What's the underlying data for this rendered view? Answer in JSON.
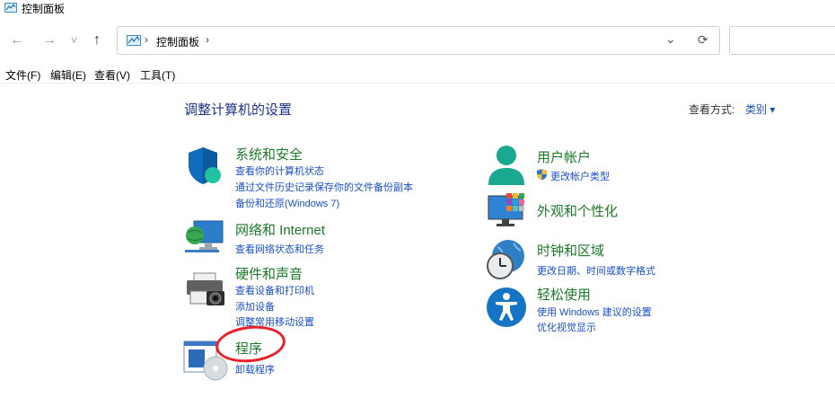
{
  "window": {
    "title": "控制面板"
  },
  "address": {
    "separator": "›",
    "location": "控制面板"
  },
  "nav": {
    "back": "←",
    "forward": "→",
    "recent": "˅",
    "up": "↑",
    "dropdown": "⌄",
    "refresh": "⟳"
  },
  "menu": {
    "file": "文件(F)",
    "edit": "编辑(E)",
    "view": "查看(V)",
    "tools": "工具(T)"
  },
  "main": {
    "heading": "调整计算机的设置"
  },
  "view_by": {
    "label": "查看方式:",
    "value": "类别",
    "arrow": "▾"
  },
  "categories": {
    "security": {
      "title": "系统和安全",
      "links": [
        "查看你的计算机状态",
        "通过文件历史记录保存你的文件备份副本",
        "备份和还原(Windows 7)"
      ],
      "icon": "shield-icon"
    },
    "network": {
      "title": "网络和 Internet",
      "links": [
        "查看网络状态和任务"
      ],
      "icon": "network-globe-icon"
    },
    "hardware": {
      "title": "硬件和声音",
      "links": [
        "查看设备和打印机",
        "添加设备",
        "调整常用移动设置"
      ],
      "icon": "printer-camera-icon"
    },
    "programs": {
      "title": "程序",
      "links": [
        "卸载程序"
      ],
      "icon": "programs-disc-icon"
    },
    "accounts": {
      "title": "用户帐户",
      "links": [
        "更改帐户类型"
      ],
      "icon": "user-icon"
    },
    "appearance": {
      "title": "外观和个性化",
      "links": [],
      "icon": "monitor-icon"
    },
    "clock": {
      "title": "时钟和区域",
      "links": [
        "更改日期、时间或数字格式"
      ],
      "icon": "clock-globe-icon"
    },
    "ease": {
      "title": "轻松使用",
      "links": [
        "使用 Windows 建议的设置",
        "优化视觉显示"
      ],
      "icon": "accessibility-icon"
    }
  },
  "colors": {
    "title_green": "#1b7a28",
    "link_blue": "#1a4fc4",
    "heading_blue": "#1e3287",
    "annotation_red": "#e8202a"
  }
}
